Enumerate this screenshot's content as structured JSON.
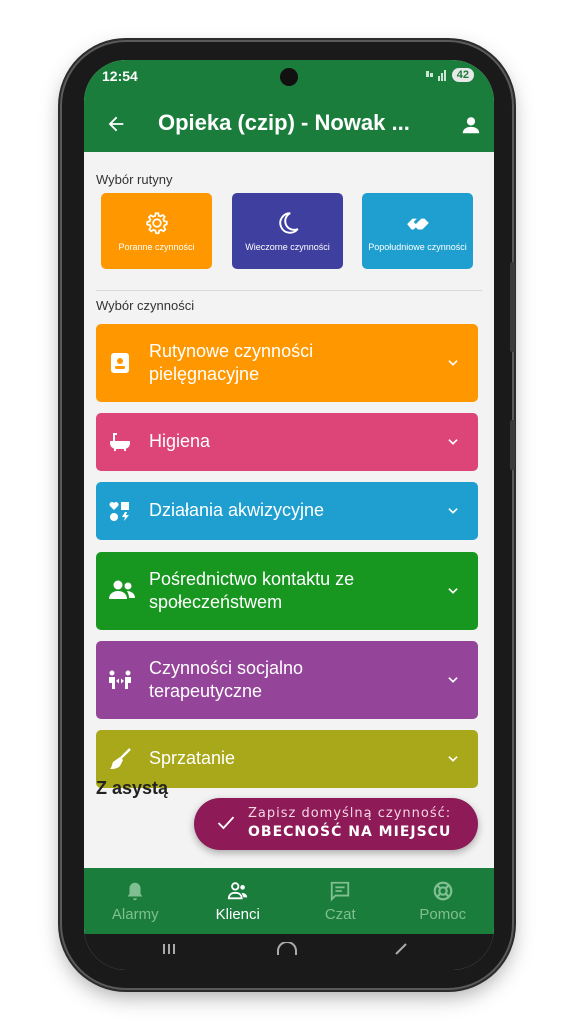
{
  "status": {
    "time": "12:54",
    "battery": "42"
  },
  "appbar": {
    "title": "Opieka (czip) - Nowak ..."
  },
  "routine": {
    "label": "Wybór rutyny",
    "buttons": [
      {
        "label": "Poranne czynności",
        "color": "#ff9800",
        "icon": "gear-icon"
      },
      {
        "label": "Wieczorne czynności",
        "color": "#3f3fa0",
        "icon": "moon-icon"
      },
      {
        "label": "Popołudniowe czynności",
        "color": "#1e9fd0",
        "icon": "handshake-icon"
      }
    ]
  },
  "activities": {
    "label": "Wybór czynności",
    "items": [
      {
        "label": "Rutynowe czynności pielęgnacyjne",
        "color": "#ff9800",
        "icon": "contact-card-icon"
      },
      {
        "label": "Higiena",
        "color": "#dd4477",
        "icon": "bathtub-icon"
      },
      {
        "label": "Działania akwizycyjne",
        "color": "#1e9fd0",
        "icon": "heart-shapes-icon"
      },
      {
        "label": "Pośrednictwo kontaktu ze społeczeństwem",
        "color": "#17971f",
        "icon": "people-icon"
      },
      {
        "label": "Czynności socjalno terapeutyczne",
        "color": "#944499",
        "icon": "people-arrows-icon"
      },
      {
        "label": "Sprzatanie",
        "color": "#a8a81a",
        "icon": "broom-icon"
      }
    ]
  },
  "assist": {
    "label": "Z asystą"
  },
  "fab": {
    "line1": "Zapisz domyślną czynność:",
    "line2": "OBECNOŚĆ NA MIEJSCU"
  },
  "nav": {
    "items": [
      {
        "label": "Alarmy",
        "icon": "bell-icon",
        "active": false
      },
      {
        "label": "Klienci",
        "icon": "clients-icon",
        "active": true
      },
      {
        "label": "Czat",
        "icon": "chat-icon",
        "active": false
      },
      {
        "label": "Pomoc",
        "icon": "lifebuoy-icon",
        "active": false
      }
    ]
  },
  "colors": {
    "primary": "#1b7d3c",
    "fab": "#8e1a57",
    "background": "#f3f3f3"
  }
}
